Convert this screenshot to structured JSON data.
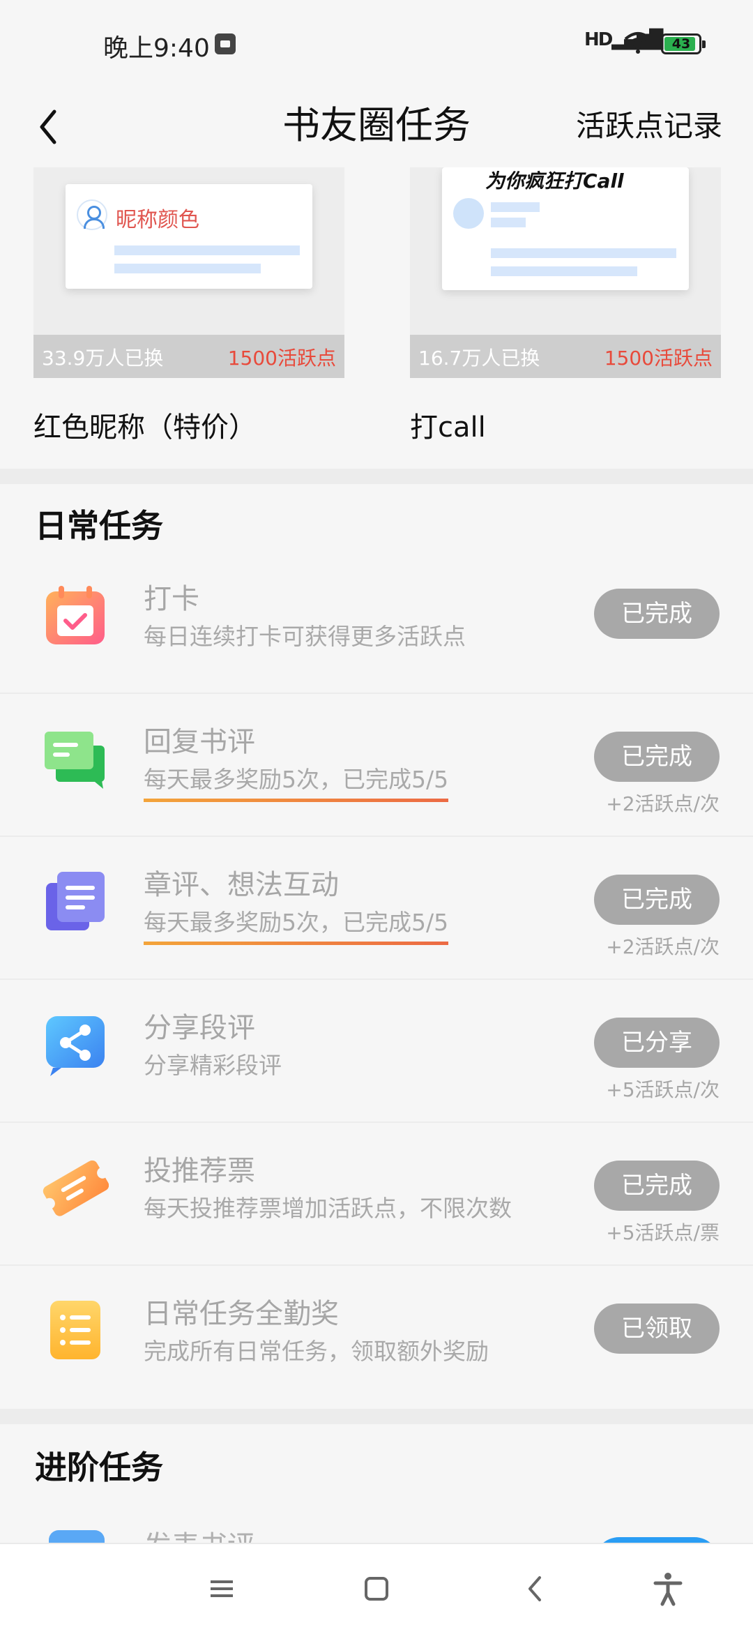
{
  "status_bar": {
    "time": "晚上9:40",
    "signal_text": "HD",
    "battery": "43"
  },
  "header": {
    "title": "书友圈任务",
    "action": "活跃点记录"
  },
  "rewards": [
    {
      "thumb_text": "昵称颜色",
      "count": "33.9万人已换",
      "price": "1500活跃点",
      "name": "红色昵称（特价）"
    },
    {
      "thumb_text": "为你疯狂打Call",
      "count": "16.7万人已换",
      "price": "1500活跃点",
      "name": "打call"
    }
  ],
  "daily": {
    "title": "日常任务",
    "tasks": [
      {
        "icon": "calendar-check-icon",
        "title": "打卡",
        "desc": "每日连续打卡可获得更多活跃点",
        "button": "已完成",
        "reward": ""
      },
      {
        "icon": "chat-bubbles-icon",
        "title": "回复书评",
        "desc": "每天最多奖励5次，已完成5/5",
        "button": "已完成",
        "reward": "+2活跃点/次"
      },
      {
        "icon": "notes-icon",
        "title": "章评、想法互动",
        "desc": "每天最多奖励5次，已完成5/5",
        "button": "已完成",
        "reward": "+2活跃点/次"
      },
      {
        "icon": "share-icon",
        "title": "分享段评",
        "desc": "分享精彩段评",
        "button": "已分享",
        "reward": "+5活跃点/次"
      },
      {
        "icon": "ticket-icon",
        "title": "投推荐票",
        "desc": "每天投推荐票增加活跃点，不限次数",
        "button": "已完成",
        "reward": "+5活跃点/票"
      },
      {
        "icon": "list-icon",
        "title": "日常任务全勤奖",
        "desc": "完成所有日常任务，领取额外奖励",
        "button": "已领取",
        "reward": ""
      }
    ]
  },
  "advanced": {
    "title": "进阶任务",
    "partial_task_title": "发表书评"
  },
  "colors": {
    "accent_red": "#e84a3b",
    "done_button": "#a8a8a8",
    "underline_start": "#f3a43a",
    "underline_end": "#ec6a44"
  }
}
